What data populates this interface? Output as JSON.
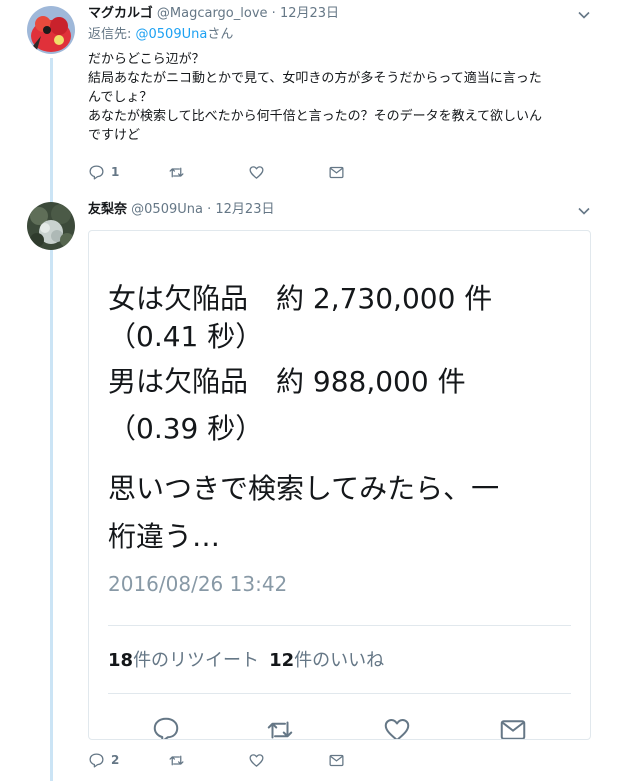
{
  "tweet1": {
    "name": "マグカルゴ",
    "handle": "@Magcargo_love",
    "separator": "·",
    "date": "12月23日",
    "reply_prefix": "返信先: ",
    "reply_mention": "@0509Una",
    "reply_suffix": "さん",
    "lines": [
      "だからどこら辺が？",
      "結局あなたがニコ動とかで見て、女叩きの方が多そうだからって適当に言った",
      "んでしょ？",
      "あなたが検索して比べたから何千倍と言ったの？そのデータを教えて欲しいん",
      "ですけど"
    ],
    "reply_count": "1"
  },
  "tweet2": {
    "name": "友梨奈",
    "handle": "@0509Una",
    "separator": "·",
    "date": "12月23日",
    "reply_count": "2",
    "card": {
      "lines": [
        "女は欠陥品　約 2,730,000 件",
        "（0.41 秒）",
        "男は欠陥品　約 988,000 件",
        "（0.39 秒）",
        "思いつきで検索してみたら、一",
        "桁違う…"
      ],
      "timestamp": "2016/08/26 13:42",
      "retweet_count": "18",
      "retweet_label": "件のリツイート",
      "like_count": "12",
      "like_label": "件のいいね"
    }
  },
  "icons": [
    "reply-icon",
    "retweet-icon",
    "like-icon",
    "dm-icon",
    "chevron-down-icon"
  ],
  "colors": {
    "link": "#1da1f2",
    "muted": "#657786",
    "thread": "#cbe4f5",
    "card_date": "#8899a6"
  }
}
